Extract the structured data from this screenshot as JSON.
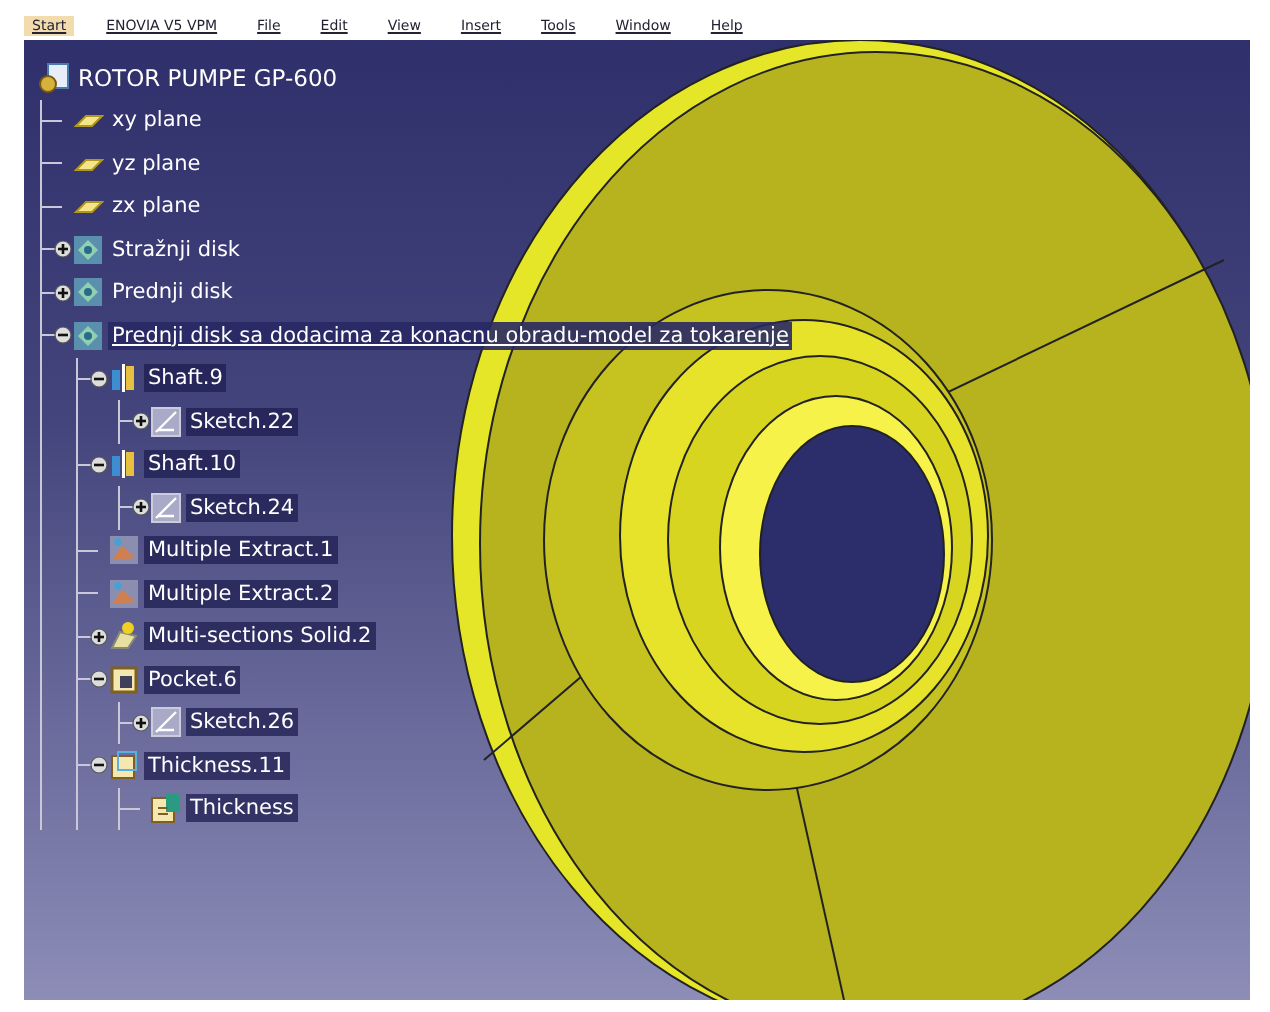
{
  "menu_bar": {
    "items": [
      {
        "label": "Start",
        "selected": true
      },
      {
        "label": "ENOVIA V5 VPM",
        "selected": false
      },
      {
        "label": "File",
        "selected": false
      },
      {
        "label": "Edit",
        "selected": false
      },
      {
        "label": "View",
        "selected": false
      },
      {
        "label": "Insert",
        "selected": false
      },
      {
        "label": "Tools",
        "selected": false
      },
      {
        "label": "Window",
        "selected": false
      },
      {
        "label": "Help",
        "selected": false
      }
    ]
  },
  "tree": {
    "root": {
      "label": "ROTOR PUMPE GP-600",
      "kind": "part",
      "highlighted": false,
      "in_work": false,
      "children": [
        {
          "label": "xy plane",
          "kind": "plane",
          "highlighted": false,
          "in_work": false
        },
        {
          "label": "yz plane",
          "kind": "plane",
          "highlighted": false,
          "in_work": false
        },
        {
          "label": "zx plane",
          "kind": "plane",
          "highlighted": false,
          "in_work": false
        },
        {
          "label": "Stražnji disk",
          "kind": "body",
          "expanded": false,
          "highlighted": false,
          "in_work": false
        },
        {
          "label": "Prednji disk",
          "kind": "body",
          "expanded": false,
          "highlighted": false,
          "in_work": false
        },
        {
          "label": "Prednji disk sa dodacima za konacnu obradu-model za tokarenje",
          "kind": "body",
          "expanded": true,
          "highlighted": false,
          "in_work": true,
          "children": [
            {
              "label": "Shaft.9",
              "kind": "shaft",
              "expanded": true,
              "highlighted": true,
              "in_work": false,
              "children": [
                {
                  "label": "Sketch.22",
                  "kind": "sketch",
                  "expanded": false,
                  "highlighted": true,
                  "in_work": false
                }
              ]
            },
            {
              "label": "Shaft.10",
              "kind": "shaft",
              "expanded": true,
              "highlighted": true,
              "in_work": false,
              "children": [
                {
                  "label": "Sketch.24",
                  "kind": "sketch",
                  "expanded": false,
                  "highlighted": true,
                  "in_work": false
                }
              ]
            },
            {
              "label": "Multiple Extract.1",
              "kind": "extract",
              "highlighted": true,
              "in_work": false
            },
            {
              "label": "Multiple Extract.2",
              "kind": "extract",
              "highlighted": true,
              "in_work": false
            },
            {
              "label": "Multi-sections Solid.2",
              "kind": "loft",
              "expanded": false,
              "highlighted": true,
              "in_work": false
            },
            {
              "label": "Pocket.6",
              "kind": "pocket",
              "expanded": true,
              "highlighted": true,
              "in_work": false,
              "children": [
                {
                  "label": "Sketch.26",
                  "kind": "sketch",
                  "expanded": false,
                  "highlighted": true,
                  "in_work": false
                }
              ]
            },
            {
              "label": "Thickness.11",
              "kind": "thickness",
              "expanded": true,
              "highlighted": true,
              "in_work": false,
              "children": [
                {
                  "label": "Thickness",
                  "kind": "thickness-param",
                  "highlighted": true,
                  "in_work": false
                }
              ]
            }
          ]
        }
      ]
    }
  }
}
